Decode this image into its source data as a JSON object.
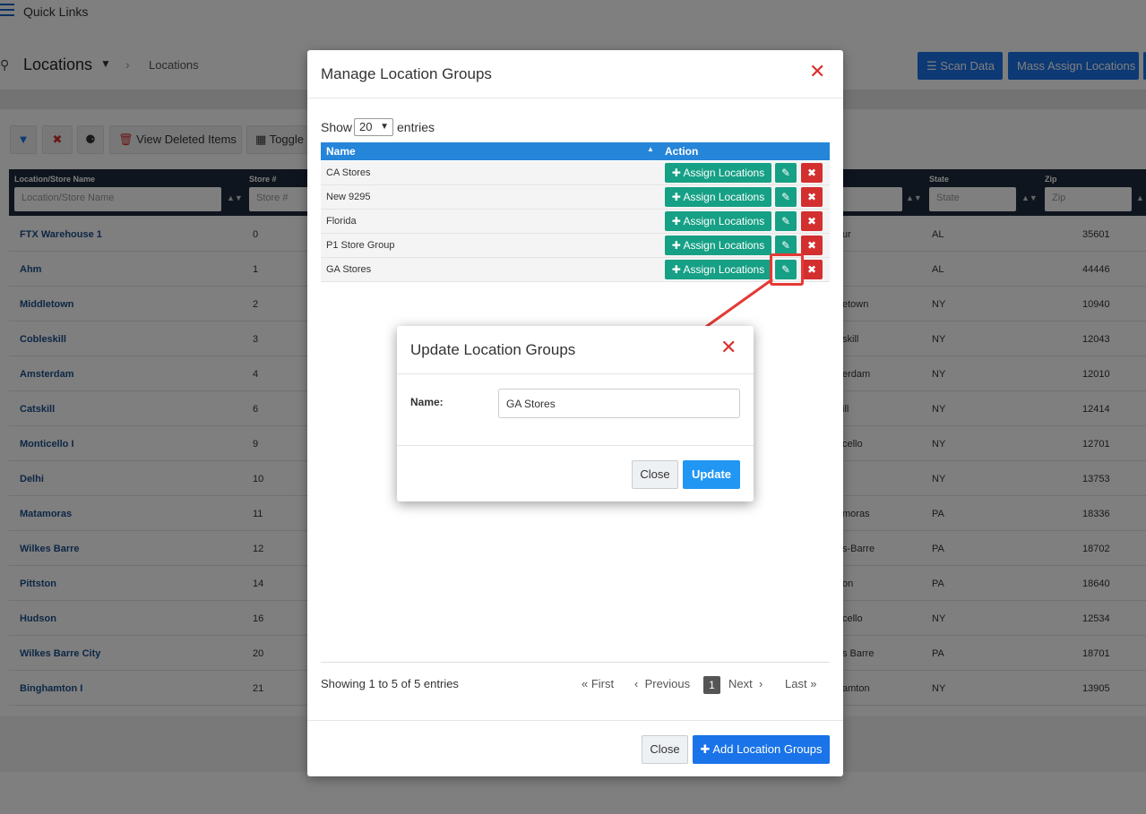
{
  "topbar": {
    "title": "Quick Links"
  },
  "page": {
    "title": "Locations",
    "breadcrumb": "Locations",
    "buttons": {
      "scan_data": "Scan Data",
      "mass_assign": "Mass Assign Locations"
    }
  },
  "toolbar": {
    "view_deleted": "View Deleted Items",
    "toggle": "Toggle"
  },
  "grid": {
    "columns": {
      "name": "Location/Store Name",
      "store": "Store #",
      "state": "State",
      "zip": "Zip"
    },
    "placeholders": {
      "name": "Location/Store Name",
      "store": "Store #",
      "state": "State",
      "zip": "Zip"
    },
    "rows": [
      {
        "name": "FTX Warehouse 1",
        "store": "0",
        "city": "ur",
        "state": "AL",
        "zip": "35601"
      },
      {
        "name": "Ahm",
        "store": "1",
        "city": "",
        "state": "AL",
        "zip": "44446"
      },
      {
        "name": "Middletown",
        "store": "2",
        "city": "etown",
        "state": "NY",
        "zip": "10940"
      },
      {
        "name": "Cobleskill",
        "store": "3",
        "city": "skill",
        "state": "NY",
        "zip": "12043"
      },
      {
        "name": "Amsterdam",
        "store": "4",
        "city": "erdam",
        "state": "NY",
        "zip": "12010"
      },
      {
        "name": "Catskill",
        "store": "6",
        "city": "ill",
        "state": "NY",
        "zip": "12414"
      },
      {
        "name": "Monticello I",
        "store": "9",
        "city": "cello",
        "state": "NY",
        "zip": "12701"
      },
      {
        "name": "Delhi",
        "store": "10",
        "city": "",
        "state": "NY",
        "zip": "13753"
      },
      {
        "name": "Matamoras",
        "store": "11",
        "city": "moras",
        "state": "PA",
        "zip": "18336"
      },
      {
        "name": "Wilkes Barre",
        "store": "12",
        "city": "s-Barre",
        "state": "PA",
        "zip": "18702"
      },
      {
        "name": "Pittston",
        "store": "14",
        "city": "on",
        "state": "PA",
        "zip": "18640"
      },
      {
        "name": "Hudson",
        "store": "16",
        "city": "cello",
        "state": "NY",
        "zip": "12534"
      },
      {
        "name": "Wilkes Barre City",
        "store": "20",
        "city": "s Barre",
        "state": "PA",
        "zip": "18701"
      },
      {
        "name": "Binghamton I",
        "store": "21",
        "city": "amton",
        "state": "NY",
        "zip": "13905"
      }
    ]
  },
  "manage_modal": {
    "title": "Manage Location Groups",
    "show_label": "Show",
    "page_size": "20",
    "entries_label": "entries",
    "headers": {
      "name": "Name",
      "action": "Action"
    },
    "assign_label": "Assign Locations",
    "groups": [
      {
        "name": "CA Stores"
      },
      {
        "name": "New 9295"
      },
      {
        "name": "Florida"
      },
      {
        "name": "P1 Store Group"
      },
      {
        "name": "GA Stores"
      }
    ],
    "showing": "Showing 1 to 5 of 5 entries",
    "pager": {
      "first": "First",
      "previous": "Previous",
      "page": "1",
      "next": "Next",
      "last": "Last"
    },
    "close_label": "Close",
    "add_label": "Add Location Groups"
  },
  "update_modal": {
    "title": "Update Location Groups",
    "name_label": "Name:",
    "name_value": "GA Stores",
    "close_label": "Close",
    "update_label": "Update"
  },
  "colors": {
    "primary": "#1a73e8",
    "success": "#16a085",
    "danger": "#d32f2f",
    "table_header": "#2585d9",
    "grid_header": "#1e2b3c",
    "annotation": "#e53935"
  }
}
